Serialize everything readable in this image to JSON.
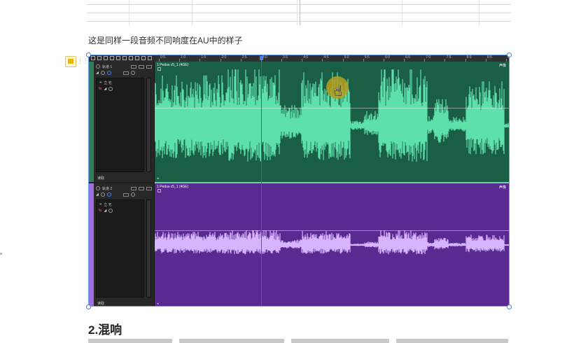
{
  "caption": "这是同样一段音频不同响度在AU中的样子",
  "section_heading": "2.混响",
  "au": {
    "ruler_labels": [
      "0:5",
      "1:0",
      "1:5",
      "2:0",
      "2:5",
      "3:0",
      "3:5",
      "4:0",
      "4:5",
      "5:0",
      "5:5",
      "6:0",
      "6:5",
      "7:0",
      "7:5",
      "8:0",
      "8:5",
      "9:0"
    ],
    "tracks": [
      {
        "name": "轨道 1",
        "input": "立 无",
        "footer": "读取",
        "clip_title": "1 Pedus c5_1 (4GE)",
        "clip_right": "声像",
        "color": "#1b5e46",
        "wave_color": "#5ee0aa",
        "bar_color": "#2e7d5c"
      },
      {
        "name": "轨道 2",
        "input": "立 无",
        "footer": "读取",
        "clip_title": "1 Pedus c5_1 (4GE)",
        "clip_right": "声像",
        "color": "#592a8f",
        "wave_color": "#d8b4ff",
        "bar_color": "#a06ee0"
      }
    ]
  }
}
